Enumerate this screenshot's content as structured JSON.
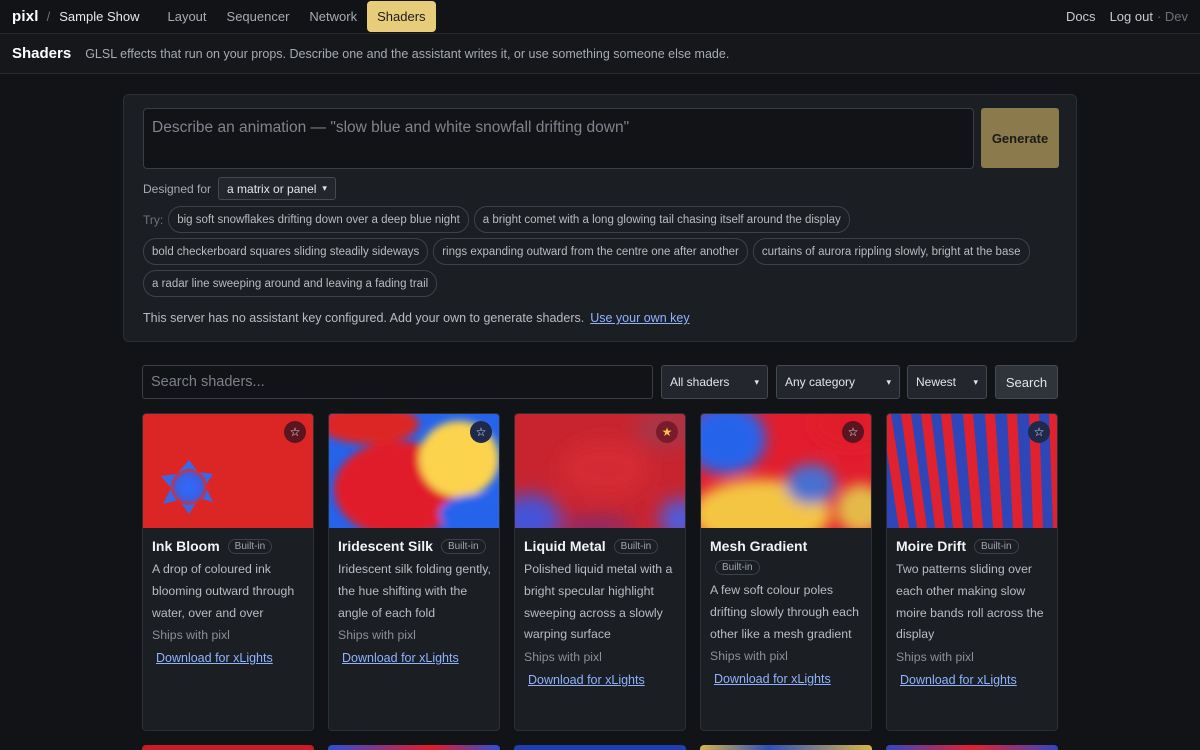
{
  "nav": {
    "brand": "pixl",
    "separator": "/",
    "show": "Sample Show",
    "links": [
      "Layout",
      "Sequencer",
      "Network",
      "Shaders"
    ],
    "active": "Shaders",
    "right": {
      "docs": "Docs",
      "logout": "Log out",
      "dev": "· Dev"
    }
  },
  "header": {
    "title": "Shaders",
    "subtitle": "GLSL effects that run on your props. Describe one and the assistant writes it, or use something someone else made."
  },
  "generator": {
    "placeholder": "Describe an animation — \"slow blue and white snowfall drifting down\"",
    "generate_label": "Generate",
    "designed_label": "Designed for",
    "designed_value": "a matrix or panel",
    "try_label": "Try:",
    "suggestions": [
      "big soft snowflakes drifting down over a deep blue night",
      "a bright comet with a long glowing tail chasing itself around the display",
      "bold checkerboard squares sliding steadily sideways",
      "rings expanding outward from the centre one after another",
      "curtains of aurora rippling slowly, bright at the base",
      "a radar line sweeping around and leaving a fading trail"
    ],
    "notice": "This server has no assistant key configured. Add your own to generate shaders.",
    "notice_link": "Use your own key"
  },
  "filters": {
    "search_placeholder": "Search shaders...",
    "scope": "All shaders",
    "category": "Any category",
    "sort": "Newest",
    "search_label": "Search"
  },
  "cards": [
    {
      "title": "Ink Bloom",
      "badge": "Built-in",
      "desc": "A drop of coloured ink blooming outward through water, over and over",
      "ships": "Ships with pixl",
      "link": "Download for xLights",
      "favorite": false
    },
    {
      "title": "Iridescent Silk",
      "badge": "Built-in",
      "desc": "Iridescent silk folding gently, the hue shifting with the angle of each fold",
      "ships": "Ships with pixl",
      "link": "Download for xLights",
      "favorite": false
    },
    {
      "title": "Liquid Metal",
      "badge": "Built-in",
      "desc": "Polished liquid metal with a bright specular highlight sweeping across a slowly warping surface",
      "ships": "Ships with pixl",
      "link": "Download for xLights",
      "favorite": true
    },
    {
      "title": "Mesh Gradient",
      "badge": "Built-in",
      "desc": "A few soft colour poles drifting slowly through each other like a mesh gradient",
      "ships": "Ships with pixl",
      "link": "Download for xLights",
      "favorite": false
    },
    {
      "title": "Moire Drift",
      "badge": "Built-in",
      "desc": "Two patterns sliding over each other making slow moire bands roll across the display",
      "ships": "Ships with pixl",
      "link": "Download for xLights",
      "favorite": false
    }
  ],
  "colors": {
    "accent": "#e7cd7a",
    "link": "#8fb3ff",
    "generate": "#8b7a4b"
  }
}
